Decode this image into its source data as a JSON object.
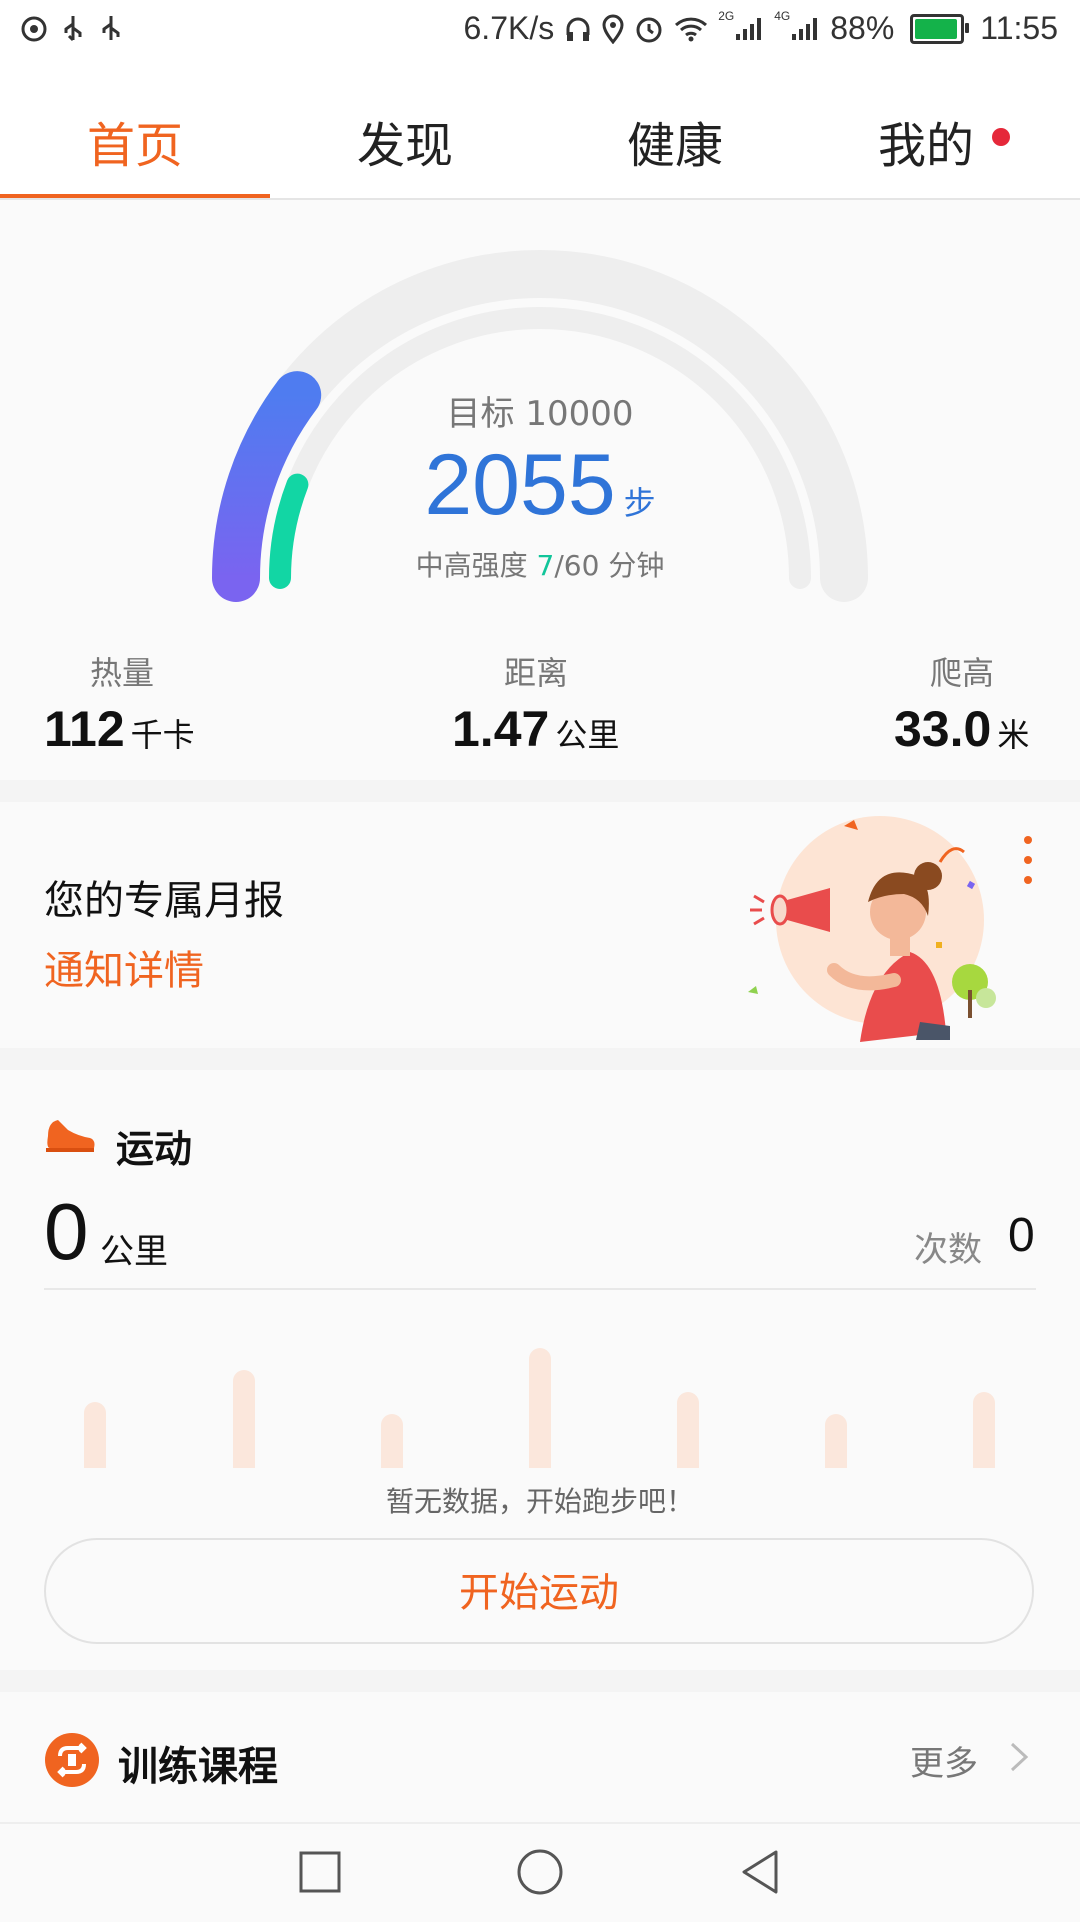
{
  "status_bar": {
    "net_speed": "6.7K/s",
    "sig2g": "2G",
    "sig4g": "4G",
    "battery": "88%",
    "time": "11:55"
  },
  "tabs": [
    {
      "label": "首页",
      "active": true
    },
    {
      "label": "发现",
      "active": false
    },
    {
      "label": "健康",
      "active": false
    },
    {
      "label": "我的",
      "active": false,
      "badge": true
    }
  ],
  "steps": {
    "goal": "目标 10000",
    "count": "2055",
    "unit": "步",
    "intensity_label": "中高强度 ",
    "intensity_value": "7",
    "intensity_total": "/60 分钟"
  },
  "gauge": {
    "steps_progress_fraction": 0.2055,
    "intensity_progress_fraction": 0.117,
    "color_steps_start": "#4f7cf0",
    "color_steps_end": "#7a64f0",
    "color_intensity": "#12d6a4"
  },
  "stats": [
    {
      "label": "热量",
      "value": "112",
      "unit": "千卡"
    },
    {
      "label": "距离",
      "value": "1.47",
      "unit": "公里"
    },
    {
      "label": "爬高",
      "value": "33.0",
      "unit": "米"
    }
  ],
  "report": {
    "title": "您的专属月报",
    "link": "通知详情"
  },
  "sport": {
    "title": "运动",
    "distance": "0",
    "distance_unit": "公里",
    "count_label": "次数",
    "count": "0",
    "empty_text": "暂无数据，开始跑步吧！",
    "start_button": "开始运动"
  },
  "course": {
    "title": "训练课程",
    "more": "更多"
  },
  "colors": {
    "accent": "#f06420",
    "steps_blue": "#2f74d8",
    "intensity_green": "#11c59a",
    "badge_red": "#e5283a"
  }
}
